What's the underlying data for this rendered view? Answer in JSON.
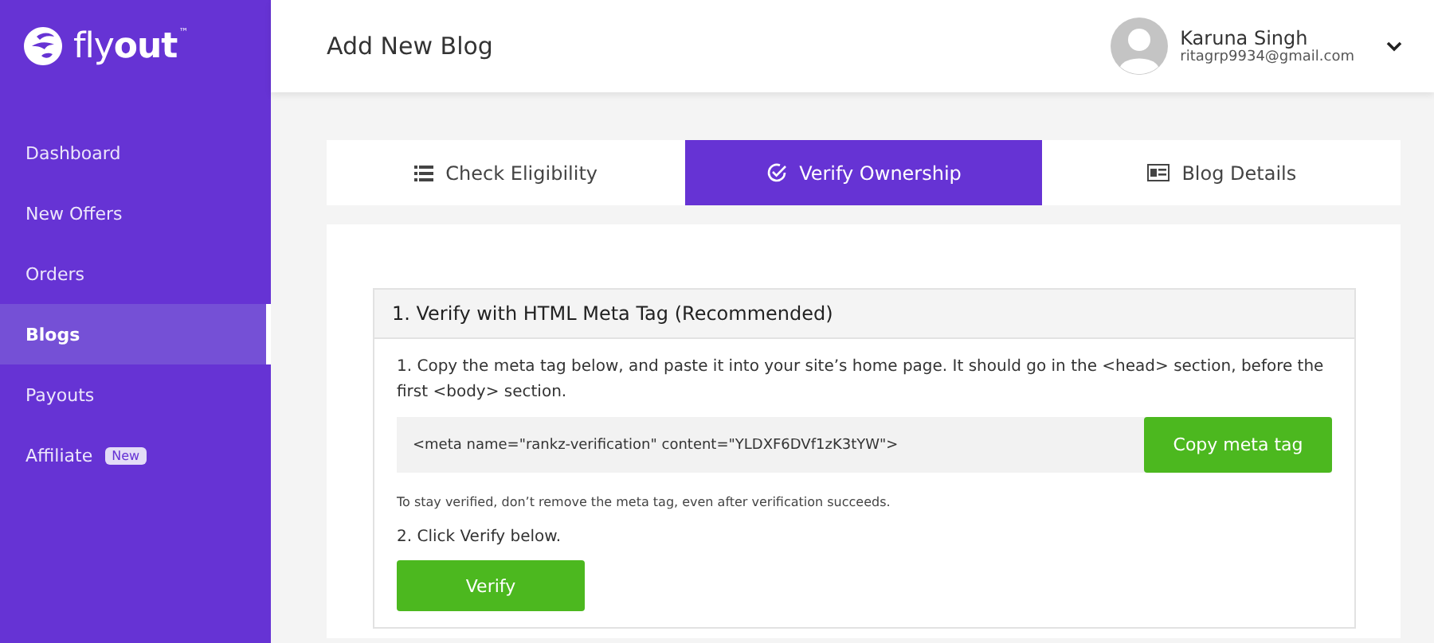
{
  "logo": {
    "light": "fly",
    "bold": "out",
    "mark": "™"
  },
  "sidebar": {
    "items": [
      {
        "label": "Dashboard",
        "selected": false
      },
      {
        "label": "New Offers",
        "selected": false
      },
      {
        "label": "Orders",
        "selected": false
      },
      {
        "label": "Blogs",
        "selected": true
      },
      {
        "label": "Payouts",
        "selected": false
      },
      {
        "label": "Affiliate",
        "selected": false,
        "badge": "New"
      }
    ]
  },
  "header": {
    "title": "Add New Blog",
    "user": {
      "name": "Karuna Singh",
      "email": "ritagrp9934@gmail.com"
    }
  },
  "tabs": [
    {
      "label": "Check Eligibility",
      "selected": false
    },
    {
      "label": "Verify Ownership",
      "selected": true
    },
    {
      "label": "Blog Details",
      "selected": false
    }
  ],
  "panel": {
    "title": "1. Verify with HTML Meta Tag (Recommended)",
    "step1": "1. Copy the meta tag below, and paste it into your site’s home page. It should go in the <head> section, before the first <body> section.",
    "meta_tag": "<meta name=\"rankz-verification\" content=\"YLDXF6DVf1zK3tYW\">",
    "copy_button": "Copy meta tag",
    "note": "To stay verified, don’t remove the meta tag, even after verification succeeds.",
    "step2": "2. Click Verify below.",
    "verify_button": "Verify"
  }
}
